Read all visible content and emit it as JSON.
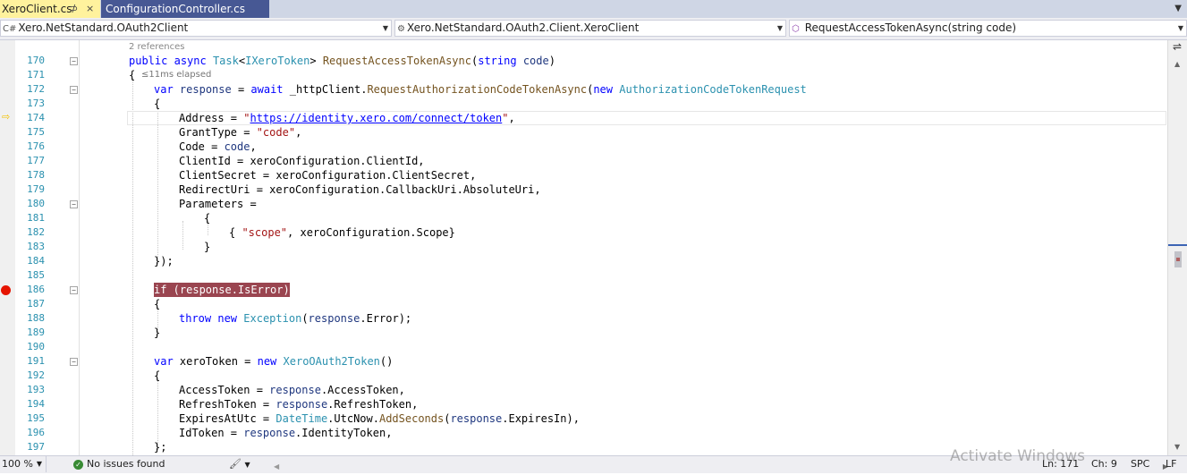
{
  "tabs": [
    {
      "label": "XeroClient.cs",
      "pin": "⊅",
      "close": "×",
      "active": true
    },
    {
      "label": "ConfigurationController.cs",
      "active": false
    }
  ],
  "navbar": {
    "project": "Xero.NetStandard.OAuth2Client",
    "class": "Xero.NetStandard.OAuth2.Client.XeroClient",
    "member": "RequestAccessTokenAsync(string code)"
  },
  "editor": {
    "references_hint": "2 references",
    "elapsed_hint": "≤11ms elapsed",
    "line_numbers": [
      "170",
      "171",
      "172",
      "173",
      "174",
      "175",
      "176",
      "177",
      "178",
      "179",
      "180",
      "181",
      "182",
      "183",
      "184",
      "185",
      "186",
      "187",
      "188",
      "189",
      "190",
      "191",
      "192",
      "193",
      "194",
      "195",
      "196",
      "197"
    ],
    "current_line": "171",
    "breakpoint_line": "186",
    "code": {
      "l170": {
        "public": "public",
        "async": "async",
        "task": "Task",
        "lt": "<",
        "ixt": "IXeroToken",
        "gt": ">",
        "method": "RequestAccessTokenAsync",
        "paren": "(",
        "string": "string",
        "code": "code",
        "close": ")"
      },
      "l171": "{",
      "l172": {
        "var": "var",
        "response": "response",
        "eq": " = ",
        "await": "await",
        "call": " _httpClient.",
        "method": "RequestAuthorizationCodeTokenAsync",
        "paren": "(",
        "new": "new",
        "type": "AuthorizationCodeTokenRequest"
      },
      "l173": "{",
      "l174": {
        "prop": "Address = ",
        "url": "\"https://identity.xero.com/connect/token\"",
        "end": ","
      },
      "l175": {
        "prop": "GrantType = ",
        "str": "\"code\"",
        "end": ","
      },
      "l176": {
        "prop": "Code = ",
        "param": "code",
        "end": ","
      },
      "l177": "ClientId = xeroConfiguration.ClientId,",
      "l178": "ClientSecret = xeroConfiguration.ClientSecret,",
      "l179": "RedirectUri = xeroConfiguration.CallbackUri.AbsoluteUri,",
      "l180": "Parameters =",
      "l181": "{",
      "l182": {
        "open": "{ ",
        "str": "\"scope\"",
        "rest": ", xeroConfiguration.Scope}"
      },
      "l183": "}",
      "l184": "});",
      "l186": "if (response.IsError)",
      "l187": "{",
      "l188": {
        "throw": "throw",
        "new": "new",
        "type": "Exception",
        "open": "(",
        "param": "response",
        "rest": ".Error);"
      },
      "l189": "}",
      "l191": {
        "var": "var",
        "name": " xeroToken = ",
        "new": "new",
        "type": "XeroOAuth2Token",
        "rest": "()"
      },
      "l192": "{",
      "l193": {
        "prop": "AccessToken = ",
        "param": "response",
        "rest": ".AccessToken,"
      },
      "l194": {
        "prop": "RefreshToken = ",
        "param": "response",
        "rest": ".RefreshToken,"
      },
      "l195": {
        "prop": "ExpiresAtUtc = ",
        "type": "DateTime",
        "mid": ".UtcNow.",
        "method": "AddSeconds",
        "open": "(",
        "param": "response",
        "rest": ".ExpiresIn),"
      },
      "l196": {
        "prop": "IdToken = ",
        "param": "response",
        "rest": ".IdentityToken,"
      },
      "l197": "};"
    }
  },
  "statusbar": {
    "zoom": "100 %",
    "issues": "No issues found",
    "ln": "Ln: 171",
    "ch": "Ch: 9",
    "spc": "SPC",
    "lf": "LF"
  },
  "watermark": "Activate Windows",
  "icons": {
    "check": "✓",
    "brush": "🖌",
    "split": "⇌",
    "arrow_down": "▼",
    "arrow_up": "▲",
    "arrow_left": "◀",
    "arrow_right": "▶",
    "cs_file": "C#",
    "class_icon": "⚙",
    "method_icon": "⬡",
    "exec": "⇨"
  },
  "colors": {
    "keyword": "#0000ff",
    "type": "#2b91af",
    "string": "#a31515",
    "breakpoint": "#e51400",
    "active_tab": "#fff29d",
    "inactive_tab": "#475894"
  }
}
